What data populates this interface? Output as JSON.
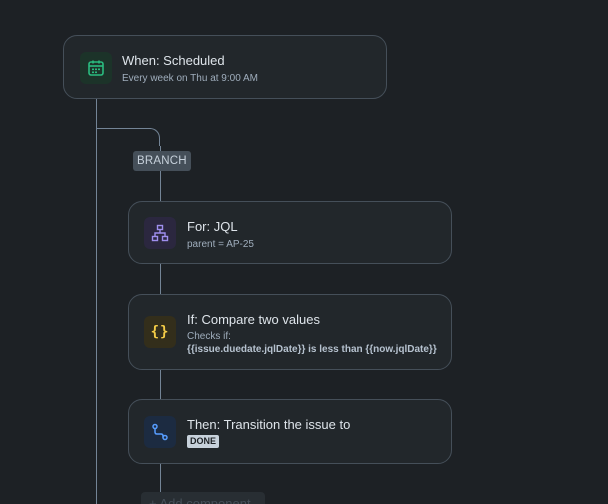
{
  "trigger": {
    "icon": "calendar-icon",
    "title": "When: Scheduled",
    "subtitle": "Every week on Thu at 9:00 AM",
    "icon_color": "#2abb7f",
    "icon_bg": "#1c3329"
  },
  "branch": {
    "label": "BRANCH"
  },
  "for_step": {
    "icon": "hierarchy-icon",
    "title": "For: JQL",
    "subtitle": "parent = AP-25",
    "icon_color": "#9f8fef",
    "icon_bg": "#2b273f"
  },
  "if_step": {
    "icon": "braces-icon",
    "title": "If: Compare two values",
    "subtitle_prefix": "Checks if:",
    "condition": "{{issue.duedate.jqlDate}} is less than {{now.jqlDate}}",
    "icon_color": "#f5cd47",
    "icon_bg": "#332e1b"
  },
  "then_step": {
    "icon": "transition-icon",
    "title": "Then: Transition the issue to",
    "status": "DONE",
    "icon_color": "#579dff",
    "icon_bg": "#1c2b41"
  },
  "add_component": {
    "label": "+ Add component"
  }
}
